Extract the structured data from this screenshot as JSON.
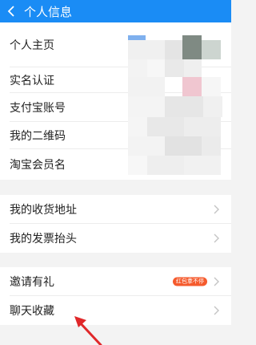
{
  "header": {
    "title": "个人信息",
    "back_icon": "back-arrow-icon"
  },
  "profile_section": {
    "items": [
      {
        "label": "个人主页"
      },
      {
        "label": "实名认证"
      },
      {
        "label": "支付宝账号"
      },
      {
        "label": "我的二维码"
      },
      {
        "label": "淘宝会员名"
      }
    ]
  },
  "address_section": {
    "items": [
      {
        "label": "我的收货地址"
      },
      {
        "label": "我的发票抬头"
      }
    ]
  },
  "other_section": {
    "items": [
      {
        "label": "邀请有礼",
        "badge": "红包拿不停"
      },
      {
        "label": "聊天收藏"
      }
    ]
  },
  "colors": {
    "header": "#1a8cf5",
    "badge": "#f55a2c",
    "annotation_arrow": "#e0282a"
  }
}
